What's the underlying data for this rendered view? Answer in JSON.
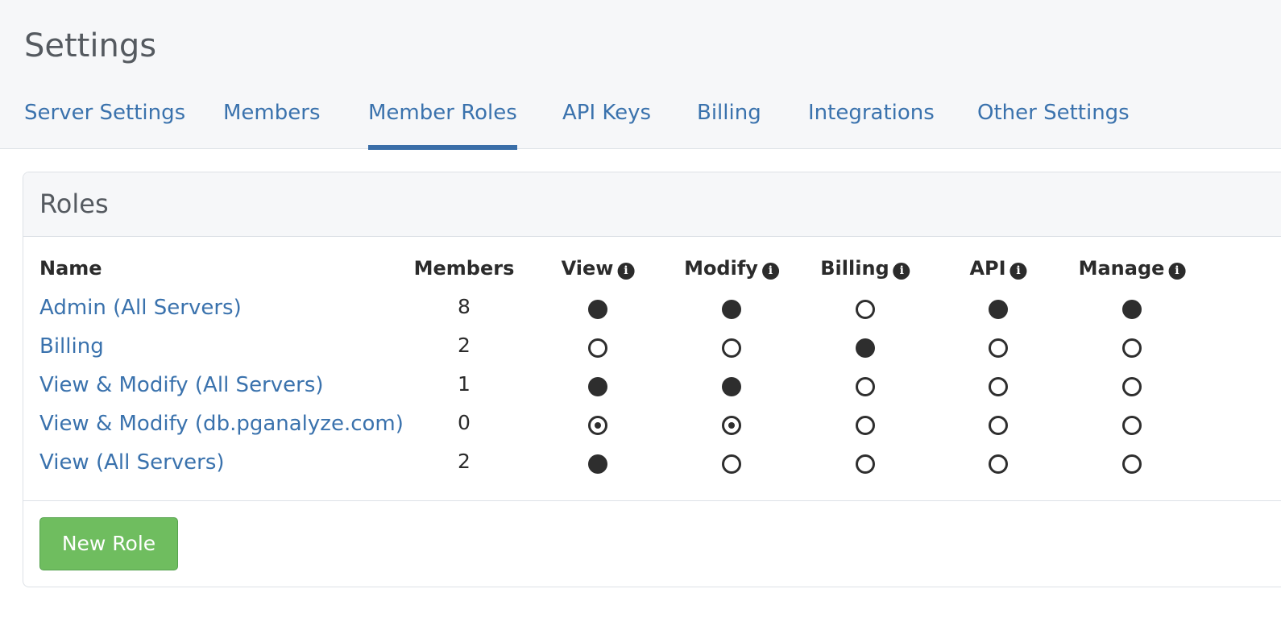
{
  "header": {
    "title": "Settings",
    "tabs": [
      {
        "label": "Server Settings",
        "active": false
      },
      {
        "label": "Members",
        "active": false
      },
      {
        "label": "Member Roles",
        "active": true
      },
      {
        "label": "API Keys",
        "active": false
      },
      {
        "label": "Billing",
        "active": false
      },
      {
        "label": "Integrations",
        "active": false
      },
      {
        "label": "Other Settings",
        "active": false
      }
    ]
  },
  "roles": {
    "title": "Roles",
    "columns": {
      "name": "Name",
      "members": "Members",
      "view": "View",
      "modify": "Modify",
      "billing": "Billing",
      "api": "API",
      "manage": "Manage"
    },
    "rows": [
      {
        "name": "Admin (All Servers)",
        "members": "8",
        "view": "full",
        "modify": "full",
        "billing": "empty",
        "api": "full",
        "manage": "full"
      },
      {
        "name": "Billing",
        "members": "2",
        "view": "empty",
        "modify": "empty",
        "billing": "full",
        "api": "empty",
        "manage": "empty"
      },
      {
        "name": "View & Modify (All Servers)",
        "members": "1",
        "view": "full",
        "modify": "full",
        "billing": "empty",
        "api": "empty",
        "manage": "empty"
      },
      {
        "name": "View & Modify (db.pganalyze.com)",
        "members": "0",
        "view": "partial",
        "modify": "partial",
        "billing": "empty",
        "api": "empty",
        "manage": "empty"
      },
      {
        "name": "View (All Servers)",
        "members": "2",
        "view": "full",
        "modify": "empty",
        "billing": "empty",
        "api": "empty",
        "manage": "empty"
      }
    ],
    "new_role_label": "New Role"
  }
}
